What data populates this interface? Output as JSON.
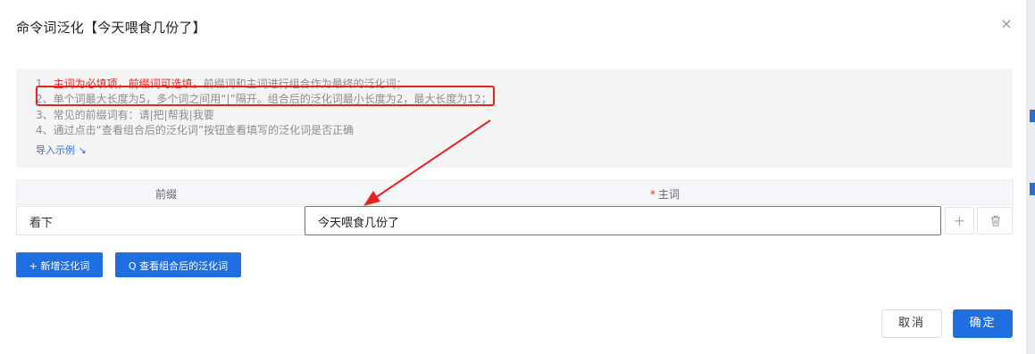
{
  "dialog": {
    "title": "命令词泛化【今天喂食几份了】",
    "close_glyph": "×"
  },
  "notice": {
    "line1_num": "1、",
    "line1_red": "主词为必填项，前缀词可选填。",
    "line1_rest": "前缀词和主词进行组合作为最终的泛化词；",
    "line2": "2、单个词最大长度为5，多个词之间用“|”隔开。组合后的泛化词最小长度为2，最大长度为12；",
    "line3": "3、常见的前缀词有：请|把|帮我|我要",
    "line4": "4、通过点击“查看组合后的泛化词”按钮查看填写的泛化词是否正确",
    "import_link": "导入示例 ↘"
  },
  "table": {
    "col_prefix": "前缀",
    "col_main_star": "*",
    "col_main": "主词",
    "row_prefix_value": "看下",
    "row_main_value": "今天喂食几份了",
    "plus_glyph": "+"
  },
  "buttons": {
    "add_label": "+ 新增泛化词",
    "view_label": "Q 查看组合后的泛化词",
    "cancel_label": "取消",
    "ok_label": "确定"
  },
  "colors": {
    "accent": "#1f6fe0",
    "annotation_red": "#e5241f"
  }
}
